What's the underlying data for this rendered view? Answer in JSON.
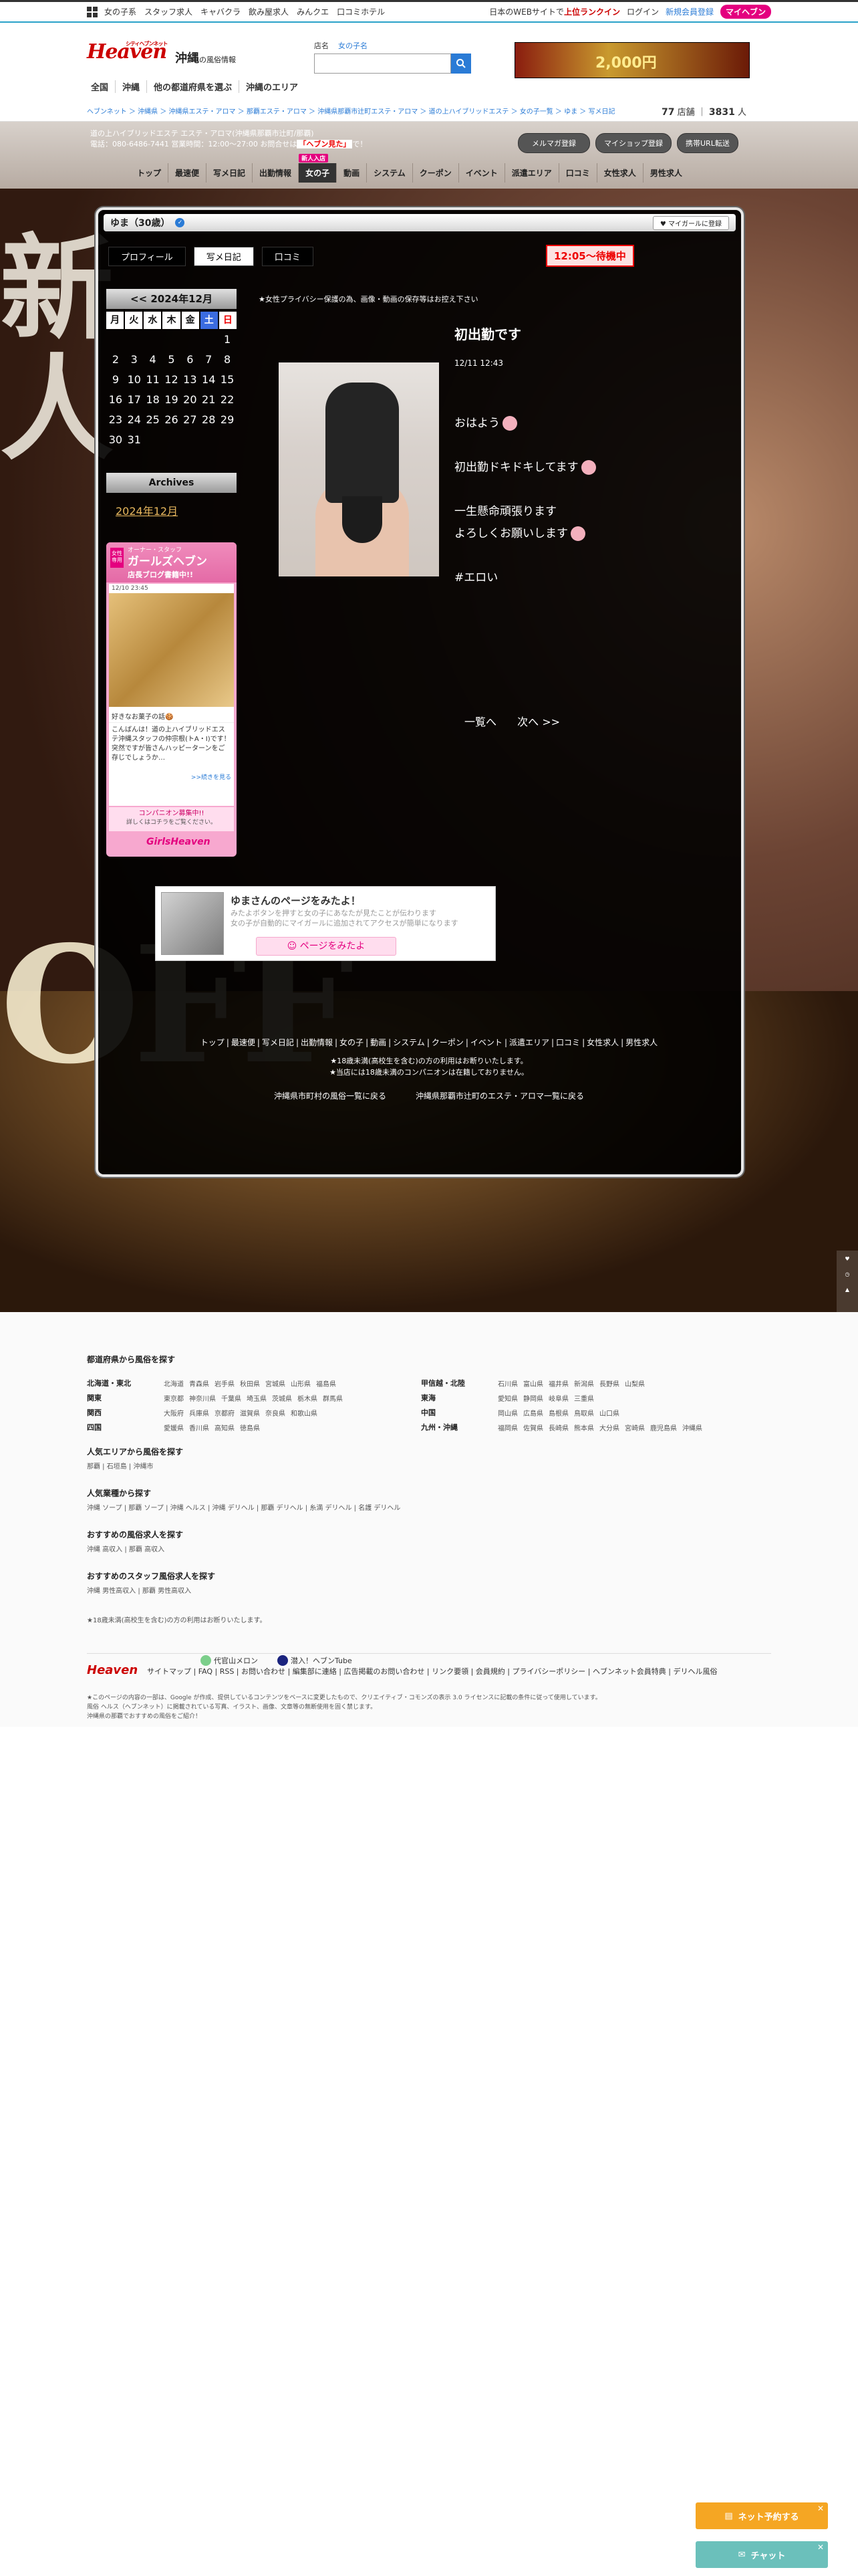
{
  "topbar": {
    "links": [
      "女の子系",
      "スタッフ求人",
      "キャバクラ",
      "飲み屋求人",
      "みんクエ",
      "口コミホテル"
    ],
    "promo": "日本のWEBサイトで",
    "promo_red": "上位ランクイン",
    "login": "ログイン",
    "register": "新規会員登録",
    "myheaven": "マイヘブン"
  },
  "header": {
    "logo": "Heaven",
    "logo_sub": "シティヘブンネット",
    "area": "沖縄",
    "area_sub": "の風俗情報",
    "search_label": "店名",
    "search_tab": "女の子名",
    "banner_text": "2,000円"
  },
  "nav1": [
    "全国",
    "沖縄",
    "他の都道府県を選ぶ",
    "沖縄のエリア"
  ],
  "breadcrumb": "ヘブンネット ＞ 沖縄県 ＞ 沖縄県エステ・アロマ ＞ 那覇エステ・アロマ ＞ 沖縄県那覇市辻町エステ・アロマ ＞ 道の上ハイブリッドエステ ＞ 女の子一覧 ＞ ゆま ＞ 写メ日記",
  "counts": {
    "a": "77",
    "a_unit": "店舗",
    "b": "3831",
    "b_unit": "人"
  },
  "shop": {
    "line1": "道の上ハイブリッドエステ エステ・アロマ(沖縄県那覇市辻町/那覇)",
    "line2": "電話：080-6486-7441 営業時間：12:00〜27:00 お問合せは",
    "line2_red": "「ヘブン見た」",
    "line2_end": "で！",
    "btn_mail": "メルマガ登録",
    "btn_shop": "マイショップ登録",
    "btn_url": "携帯URL転送"
  },
  "shopnav": [
    "トップ",
    "最速便",
    "写メ日記",
    "出勤情報",
    "女の子",
    "動画",
    "システム",
    "クーポン",
    "イベント",
    "派遣エリア",
    "口コミ",
    "女性求人",
    "男性求人"
  ],
  "shopnav_new": "新人入店",
  "profile": {
    "name": "ゆま（30歳）",
    "check": "✓",
    "fav": "マイガールに登録"
  },
  "tabs": [
    "プロフィール",
    "写メ日記",
    "口コミ"
  ],
  "wait_status": "12:05〜待機中",
  "calendar": {
    "title": "<< 2024年12月",
    "weekdays": [
      "月",
      "火",
      "水",
      "木",
      "金",
      "土",
      "日"
    ],
    "days": [
      "",
      "",
      "",
      "",
      "",
      "",
      "1",
      "2",
      "3",
      "4",
      "5",
      "6",
      "7",
      "8",
      "9",
      "10",
      "11",
      "12",
      "13",
      "14",
      "15",
      "16",
      "17",
      "18",
      "19",
      "20",
      "21",
      "22",
      "23",
      "24",
      "25",
      "26",
      "27",
      "28",
      "29",
      "30",
      "31"
    ]
  },
  "archives": {
    "title": "Archives",
    "item": "2024年12月"
  },
  "girlsheaven": {
    "tag": "女性専用",
    "t1": "オーナー・スタッフ",
    "t2": "ガールズヘブン",
    "t3": "店長ブログ書籍中!!",
    "time": "12/10 23:45",
    "caption": "好きなお菓子の話🍪",
    "body": "こんばんは！道の上ハイブリッドエステ沖縄スタッフの仲宗根(トA・I)です！突然ですが皆さんハッピーターンをご存じでしょうか…",
    "more": ">>続きを見る",
    "comp": "コンパニオン募集中!!",
    "comp_sub": "詳しくはコチラをご覧ください。",
    "logo": "GirlsHeaven"
  },
  "privacy_note": "★女性プライバシー保護の為、画像・動画の保存等はお控え下さい",
  "post": {
    "title": "初出勤です",
    "time": "12/11 12:43",
    "lines": [
      "おはよう",
      "",
      "初出勤ドキドキしてます",
      "",
      "一生懸命頑張ります",
      "よろしくお願いします",
      "",
      "#エロい"
    ]
  },
  "pager": {
    "list": "一覧へ",
    "next": "次へ >>"
  },
  "promo": {
    "title": "ゆまさんのページをみたよ！",
    "desc1": "みたよボタンを押すと女の子にあなたが見たことが伝わります",
    "desc2": "女の子が自動的にマイガールに追加されてアクセスが簡単になります",
    "button": "ページをみたよ"
  },
  "bglinks": [
    "トップ",
    "最速便",
    "写メ日記",
    "出勤情報",
    "女の子",
    "動画",
    "システム",
    "クーポン",
    "イベント",
    "派遣エリア",
    "口コミ",
    "女性求人",
    "男性求人"
  ],
  "bgnotes": [
    "★18歳未満(高校生を含む)の方の利用はお断りいたします。",
    "★当店には18歳未満のコンパニオンは在籍しておりません。"
  ],
  "bgshop": [
    "沖縄県市町村の風俗一覧に戻る",
    "沖縄県那覇市辻町のエステ・アロマ一覧に戻る"
  ],
  "footer": {
    "sec1": "都道府県から風俗を探す",
    "regions_left": [
      {
        "name": "北海道・東北",
        "items": [
          "北海道",
          "青森県",
          "岩手県",
          "秋田県",
          "宮城県",
          "山形県",
          "福島県"
        ]
      },
      {
        "name": "関東",
        "items": [
          "東京都",
          "神奈川県",
          "千葉県",
          "埼玉県",
          "茨城県",
          "栃木県",
          "群馬県"
        ]
      },
      {
        "name": "関西",
        "items": [
          "大阪府",
          "兵庫県",
          "京都府",
          "滋賀県",
          "奈良県",
          "和歌山県"
        ]
      },
      {
        "name": "四国",
        "items": [
          "愛媛県",
          "香川県",
          "高知県",
          "徳島県"
        ]
      }
    ],
    "regions_right": [
      {
        "name": "甲信越・北陸",
        "items": [
          "石川県",
          "富山県",
          "福井県",
          "新潟県",
          "長野県",
          "山梨県"
        ]
      },
      {
        "name": "東海",
        "items": [
          "愛知県",
          "静岡県",
          "岐阜県",
          "三重県"
        ]
      },
      {
        "name": "中国",
        "items": [
          "岡山県",
          "広島県",
          "島根県",
          "鳥取県",
          "山口県"
        ]
      },
      {
        "name": "九州・沖縄",
        "items": [
          "福岡県",
          "佐賀県",
          "長崎県",
          "熊本県",
          "大分県",
          "宮崎県",
          "鹿児島県",
          "沖縄県"
        ]
      }
    ],
    "sec2": "人気エリアから風俗を探す",
    "sec2_items": "那覇 | 石垣島 | 沖縄市",
    "sec3": "人気業種から探す",
    "sec3_items": "沖縄 ソープ | 那覇 ソープ | 沖縄 ヘルス | 沖縄 デリヘル | 那覇 デリヘル | 糸満 デリヘル | 名護 デリヘル",
    "sec4": "おすすめの風俗求人を探す",
    "sec4_items": "沖縄 高収入 | 那覇 高収入",
    "sec5": "おすすめのスタッフ風俗求人を探す",
    "sec5_items": "沖縄 男性高収入 | 那覇 男性高収入",
    "age_note": "★18歳未満(高校生を含む)の方の利用はお断りいたします。",
    "brand": "Heaven",
    "icon1": "代官山メロン",
    "icon2": "潜入！ヘブンTube",
    "links": "サイトマップ | FAQ | RSS | お問い合わせ | 編集部に連絡 | 広告掲載のお問い合わせ | リンク要領 | 会員規約 | プライバシーポリシー | ヘブンネット会員特典 | デリヘル風俗",
    "notes": [
      "★このページの内容の一部は、Google が作成、提供しているコンテンツをベースに変更したもので、クリエイティブ・コモンズの表示 3.0 ライセンスに記載の条件に従って使用しています。",
      "風俗 ヘルス（ヘブンネット）に掲載されている写真、イラスト、画像、文章等の無断使用を固く禁じます。",
      "沖縄県の那覇でおすすめの風俗をご紹介！"
    ]
  },
  "float": {
    "net": "ネット予約する",
    "chat": "チャット"
  },
  "colors": {
    "accent": "#2a7bd6",
    "pink": "#e4007f",
    "status": "#e00000"
  }
}
